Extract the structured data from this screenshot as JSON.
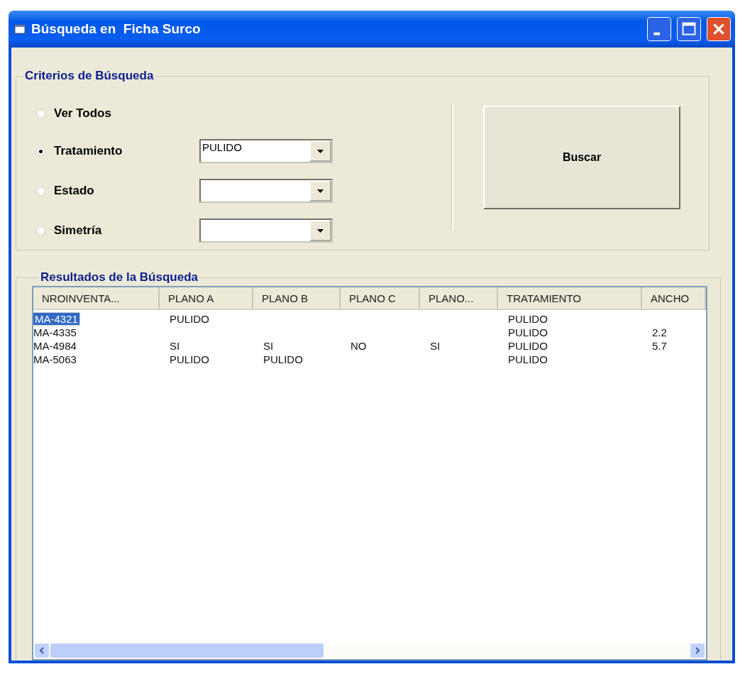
{
  "window": {
    "title": "Búsqueda en  Ficha Surco"
  },
  "criteria": {
    "title": "Criterios de Búsqueda",
    "options": [
      {
        "label": "Ver Todos",
        "selected": false,
        "kind": "plain"
      },
      {
        "label": "Tratamiento",
        "selected": true,
        "kind": "dropdown",
        "value": "PULIDO"
      },
      {
        "label": "Estado",
        "selected": false,
        "kind": "dropdown"
      },
      {
        "label": "Simetría",
        "selected": false,
        "kind": "dropdown"
      }
    ],
    "button": "Buscar"
  },
  "results": {
    "title": "Resultados de la Búsqueda",
    "columns": [
      "NROINVENTA...",
      "PLANO A",
      "PLANO B",
      "PLANO C",
      "PLANO...",
      "TRATAMIENTO",
      "ANCHO"
    ],
    "rows": [
      {
        "cells": [
          "MA-4321",
          "PULIDO",
          "",
          "",
          "",
          "PULIDO",
          ""
        ],
        "selected": true
      },
      {
        "cells": [
          "MA-4335",
          "",
          "",
          "",
          "",
          "PULIDO",
          "2.2"
        ],
        "selected": false
      },
      {
        "cells": [
          "MA-4984",
          "SI",
          "SI",
          "NO",
          "SI",
          "PULIDO",
          "5.7"
        ],
        "selected": false
      },
      {
        "cells": [
          "MA-5063",
          "PULIDO",
          "PULIDO",
          "",
          "",
          "PULIDO",
          ""
        ],
        "selected": false
      }
    ]
  }
}
